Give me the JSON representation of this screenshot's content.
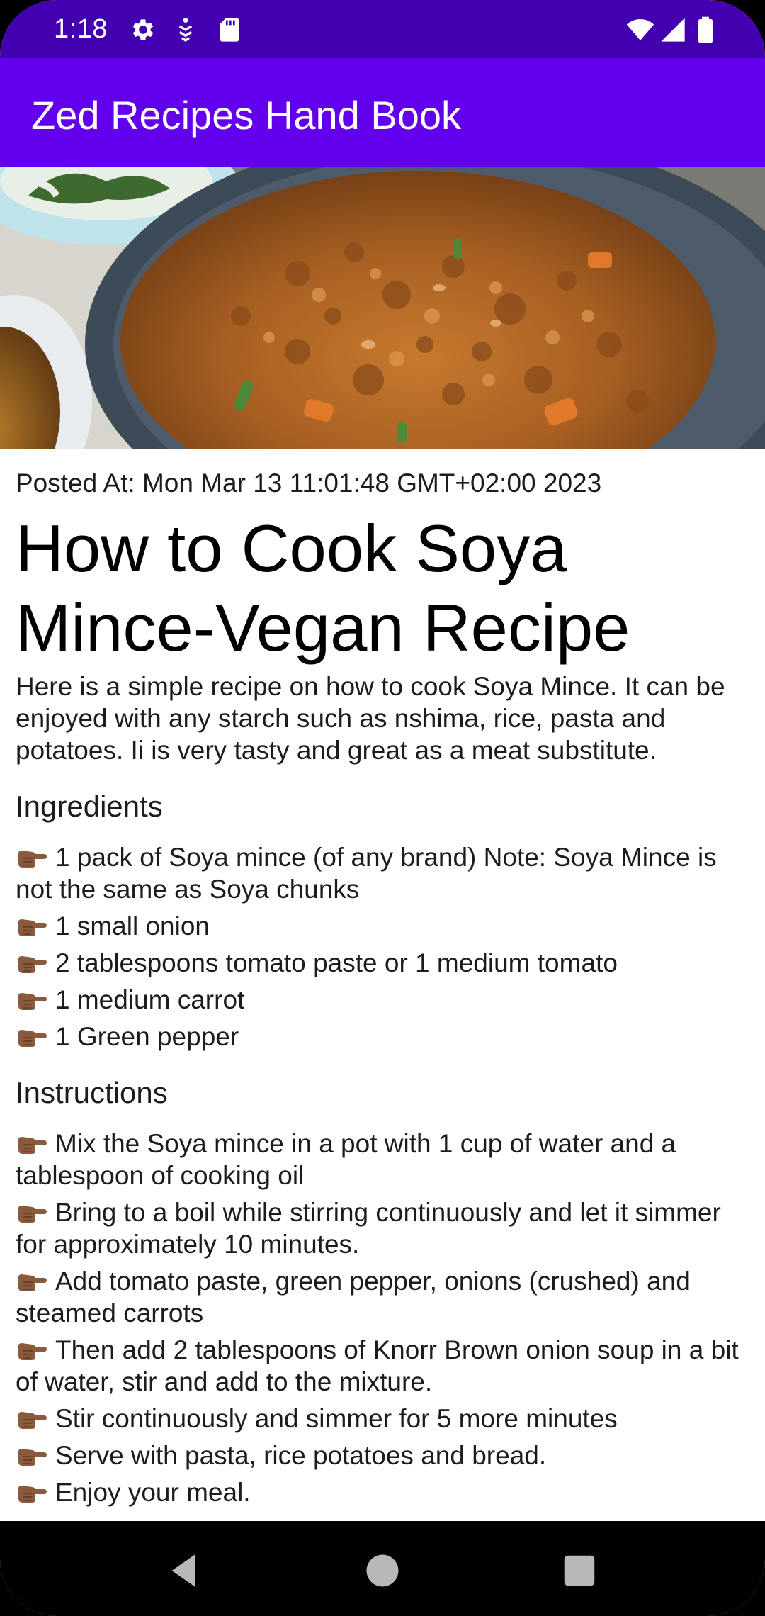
{
  "status_bar": {
    "time": "1:18",
    "left_icons": [
      "gear-icon",
      "accessibility-download-icon",
      "sd-card-icon"
    ],
    "right_icons": [
      "wifi-icon",
      "signal-icon",
      "battery-icon"
    ]
  },
  "app_bar": {
    "title": "Zed Recipes Hand Book"
  },
  "hero_image": {
    "description_icon": "soya-mince-dish-photo"
  },
  "recipe": {
    "posted": "Posted At: Mon Mar 13 11:01:48 GMT+02:00 2023",
    "title": "How to Cook Soya Mince-Vegan Recipe",
    "description": "Here is a simple recipe on how to cook Soya Mince. It can be enjoyed with any starch such as nshima, rice, pasta and potatoes. Ii is very tasty and great as a meat substitute.",
    "ingredients_heading": "Ingredients",
    "ingredients": [
      "1 pack of Soya mince (of any brand) Note: Soya Mince is not the same as Soya chunks",
      "1 small onion",
      "2 tablespoons tomato paste or 1 medium tomato",
      "1 medium carrot",
      "1 Green pepper"
    ],
    "instructions_heading": "Instructions",
    "instructions": [
      "Mix the Soya mince in a pot with 1 cup of water and a tablespoon of cooking oil",
      "Bring to a boil while stirring continuously and let it simmer for approximately 10 minutes.",
      "Add tomato paste, green pepper, onions (crushed) and steamed carrots",
      "Then add 2 tablespoons of Knorr Brown onion soup in a bit of water, stir and add to the mixture.",
      "Stir continuously and simmer for 5 more minutes",
      "Serve with pasta, rice potatoes and bread.",
      "Enjoy your meal."
    ]
  },
  "nav_bar": {
    "buttons": [
      "back-icon",
      "home-icon",
      "recents-icon"
    ]
  },
  "colors": {
    "status_bar": "#4200b0",
    "app_bar": "#6200ee",
    "text": "#1c1c1c",
    "pointer_emoji": "#8a5a3c"
  }
}
